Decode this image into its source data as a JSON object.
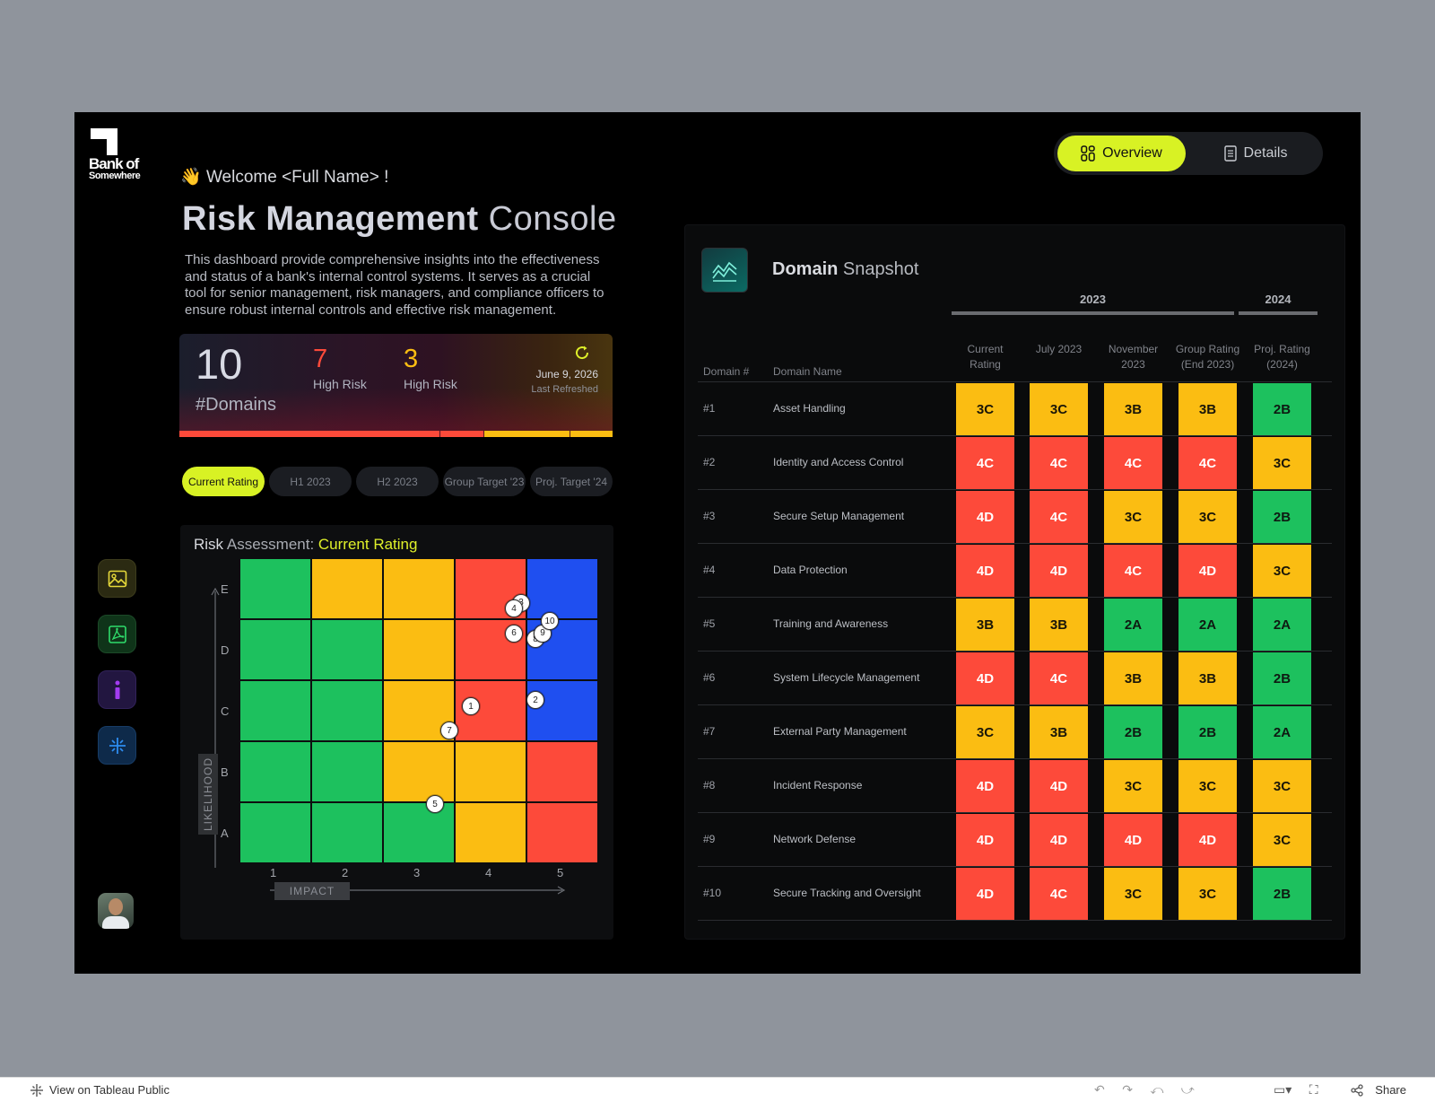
{
  "brand": {
    "line1": "Bank of",
    "line2": "Somewhere"
  },
  "header": {
    "wave": "👋",
    "welcome": "Welcome <Full Name> !",
    "title_bold": "Risk Management",
    "title_light": "Console",
    "description": "This dashboard provide comprehensive insights into the effectiveness and status of a bank's internal control systems. It serves as a crucial tool for senior management, risk managers, and compliance officers to ensure robust internal controls and effective risk management."
  },
  "kpi": {
    "domains_value": "10",
    "domains_label": "#Domains",
    "high_risk_red_value": "7",
    "high_risk_red_label": "High Risk",
    "high_risk_yellow_value": "3",
    "high_risk_yellow_label": "High Risk",
    "refresh_date": "June 9, 2026",
    "refresh_label": "Last Refreshed",
    "red_color": "#fd4a3a",
    "yellow_color": "#fbbd12"
  },
  "rating_tabs": [
    {
      "label": "Current Rating",
      "active": true
    },
    {
      "label": "H1 2023",
      "active": false
    },
    {
      "label": "H2 2023",
      "active": false
    },
    {
      "label": "Group Target '23",
      "active": false
    },
    {
      "label": "Proj. Target '24",
      "active": false
    }
  ],
  "risk_assessment": {
    "title_bold": "Risk",
    "title_light": "Assessment:",
    "title_accent": "Current Rating",
    "y_axis_label": "LIKELIHOOD",
    "x_axis_label": "IMPACT",
    "likelihood_levels": [
      "A",
      "B",
      "C",
      "D",
      "E"
    ],
    "impact_levels": [
      "1",
      "2",
      "3",
      "4",
      "5"
    ],
    "zone_colors": {
      "A": [
        "green",
        "green",
        "green",
        "yellow",
        "red"
      ],
      "B": [
        "green",
        "green",
        "yellow",
        "yellow",
        "red"
      ],
      "C": [
        "green",
        "green",
        "yellow",
        "red",
        "blue"
      ],
      "D": [
        "green",
        "green",
        "yellow",
        "red",
        "blue"
      ],
      "E": [
        "green",
        "yellow",
        "yellow",
        "red",
        "blue"
      ]
    },
    "markers": [
      {
        "label": "1",
        "impact": 3.7,
        "likelihood": 3.1
      },
      {
        "label": "2",
        "impact": 4.6,
        "likelihood": 3.2
      },
      {
        "label": "3",
        "impact": 4.4,
        "likelihood": 4.8
      },
      {
        "label": "4",
        "impact": 4.3,
        "likelihood": 4.7
      },
      {
        "label": "5",
        "impact": 3.2,
        "likelihood": 1.5
      },
      {
        "label": "6",
        "impact": 4.3,
        "likelihood": 4.3
      },
      {
        "label": "7",
        "impact": 3.4,
        "likelihood": 2.7
      },
      {
        "label": "8",
        "impact": 4.6,
        "likelihood": 4.2
      },
      {
        "label": "9",
        "impact": 4.7,
        "likelihood": 4.3
      },
      {
        "label": "10",
        "impact": 4.8,
        "likelihood": 4.5
      }
    ]
  },
  "nav": {
    "overview_label": "Overview",
    "details_label": "Details"
  },
  "snapshot": {
    "title_bold": "Domain",
    "title_light": "Snapshot",
    "year_2023": "2023",
    "year_2024": "2024",
    "col_domain_num": "Domain #",
    "col_domain_name": "Domain Name",
    "rating_columns": [
      "Current Rating",
      "July 2023",
      "November 2023",
      "Group Rating (End 2023)",
      "Proj. Rating (2024)"
    ],
    "rows": [
      {
        "id": "#1",
        "name": "Asset Handling",
        "ratings": [
          "3C",
          "3C",
          "3B",
          "3B",
          "2B"
        ]
      },
      {
        "id": "#2",
        "name": "Identity and Access Control",
        "ratings": [
          "4C",
          "4C",
          "4C",
          "4C",
          "3C"
        ]
      },
      {
        "id": "#3",
        "name": "Secure Setup Management",
        "ratings": [
          "4D",
          "4C",
          "3C",
          "3C",
          "2B"
        ]
      },
      {
        "id": "#4",
        "name": "Data Protection",
        "ratings": [
          "4D",
          "4D",
          "4C",
          "4D",
          "3C"
        ]
      },
      {
        "id": "#5",
        "name": "Training and Awareness",
        "ratings": [
          "3B",
          "3B",
          "2A",
          "2A",
          "2A"
        ]
      },
      {
        "id": "#6",
        "name": "System Lifecycle Management",
        "ratings": [
          "4D",
          "4C",
          "3B",
          "3B",
          "2B"
        ]
      },
      {
        "id": "#7",
        "name": "External Party Management",
        "ratings": [
          "3C",
          "3B",
          "2B",
          "2B",
          "2A"
        ]
      },
      {
        "id": "#8",
        "name": "Incident Response",
        "ratings": [
          "4D",
          "4D",
          "3C",
          "3C",
          "3C"
        ]
      },
      {
        "id": "#9",
        "name": "Network Defense",
        "ratings": [
          "4D",
          "4D",
          "4D",
          "4D",
          "3C"
        ]
      },
      {
        "id": "#10",
        "name": "Secure Tracking and Oversight",
        "ratings": [
          "4D",
          "4C",
          "3C",
          "3C",
          "2B"
        ]
      }
    ]
  },
  "footer": {
    "view_label": "View on Tableau Public",
    "share_label": "Share"
  }
}
